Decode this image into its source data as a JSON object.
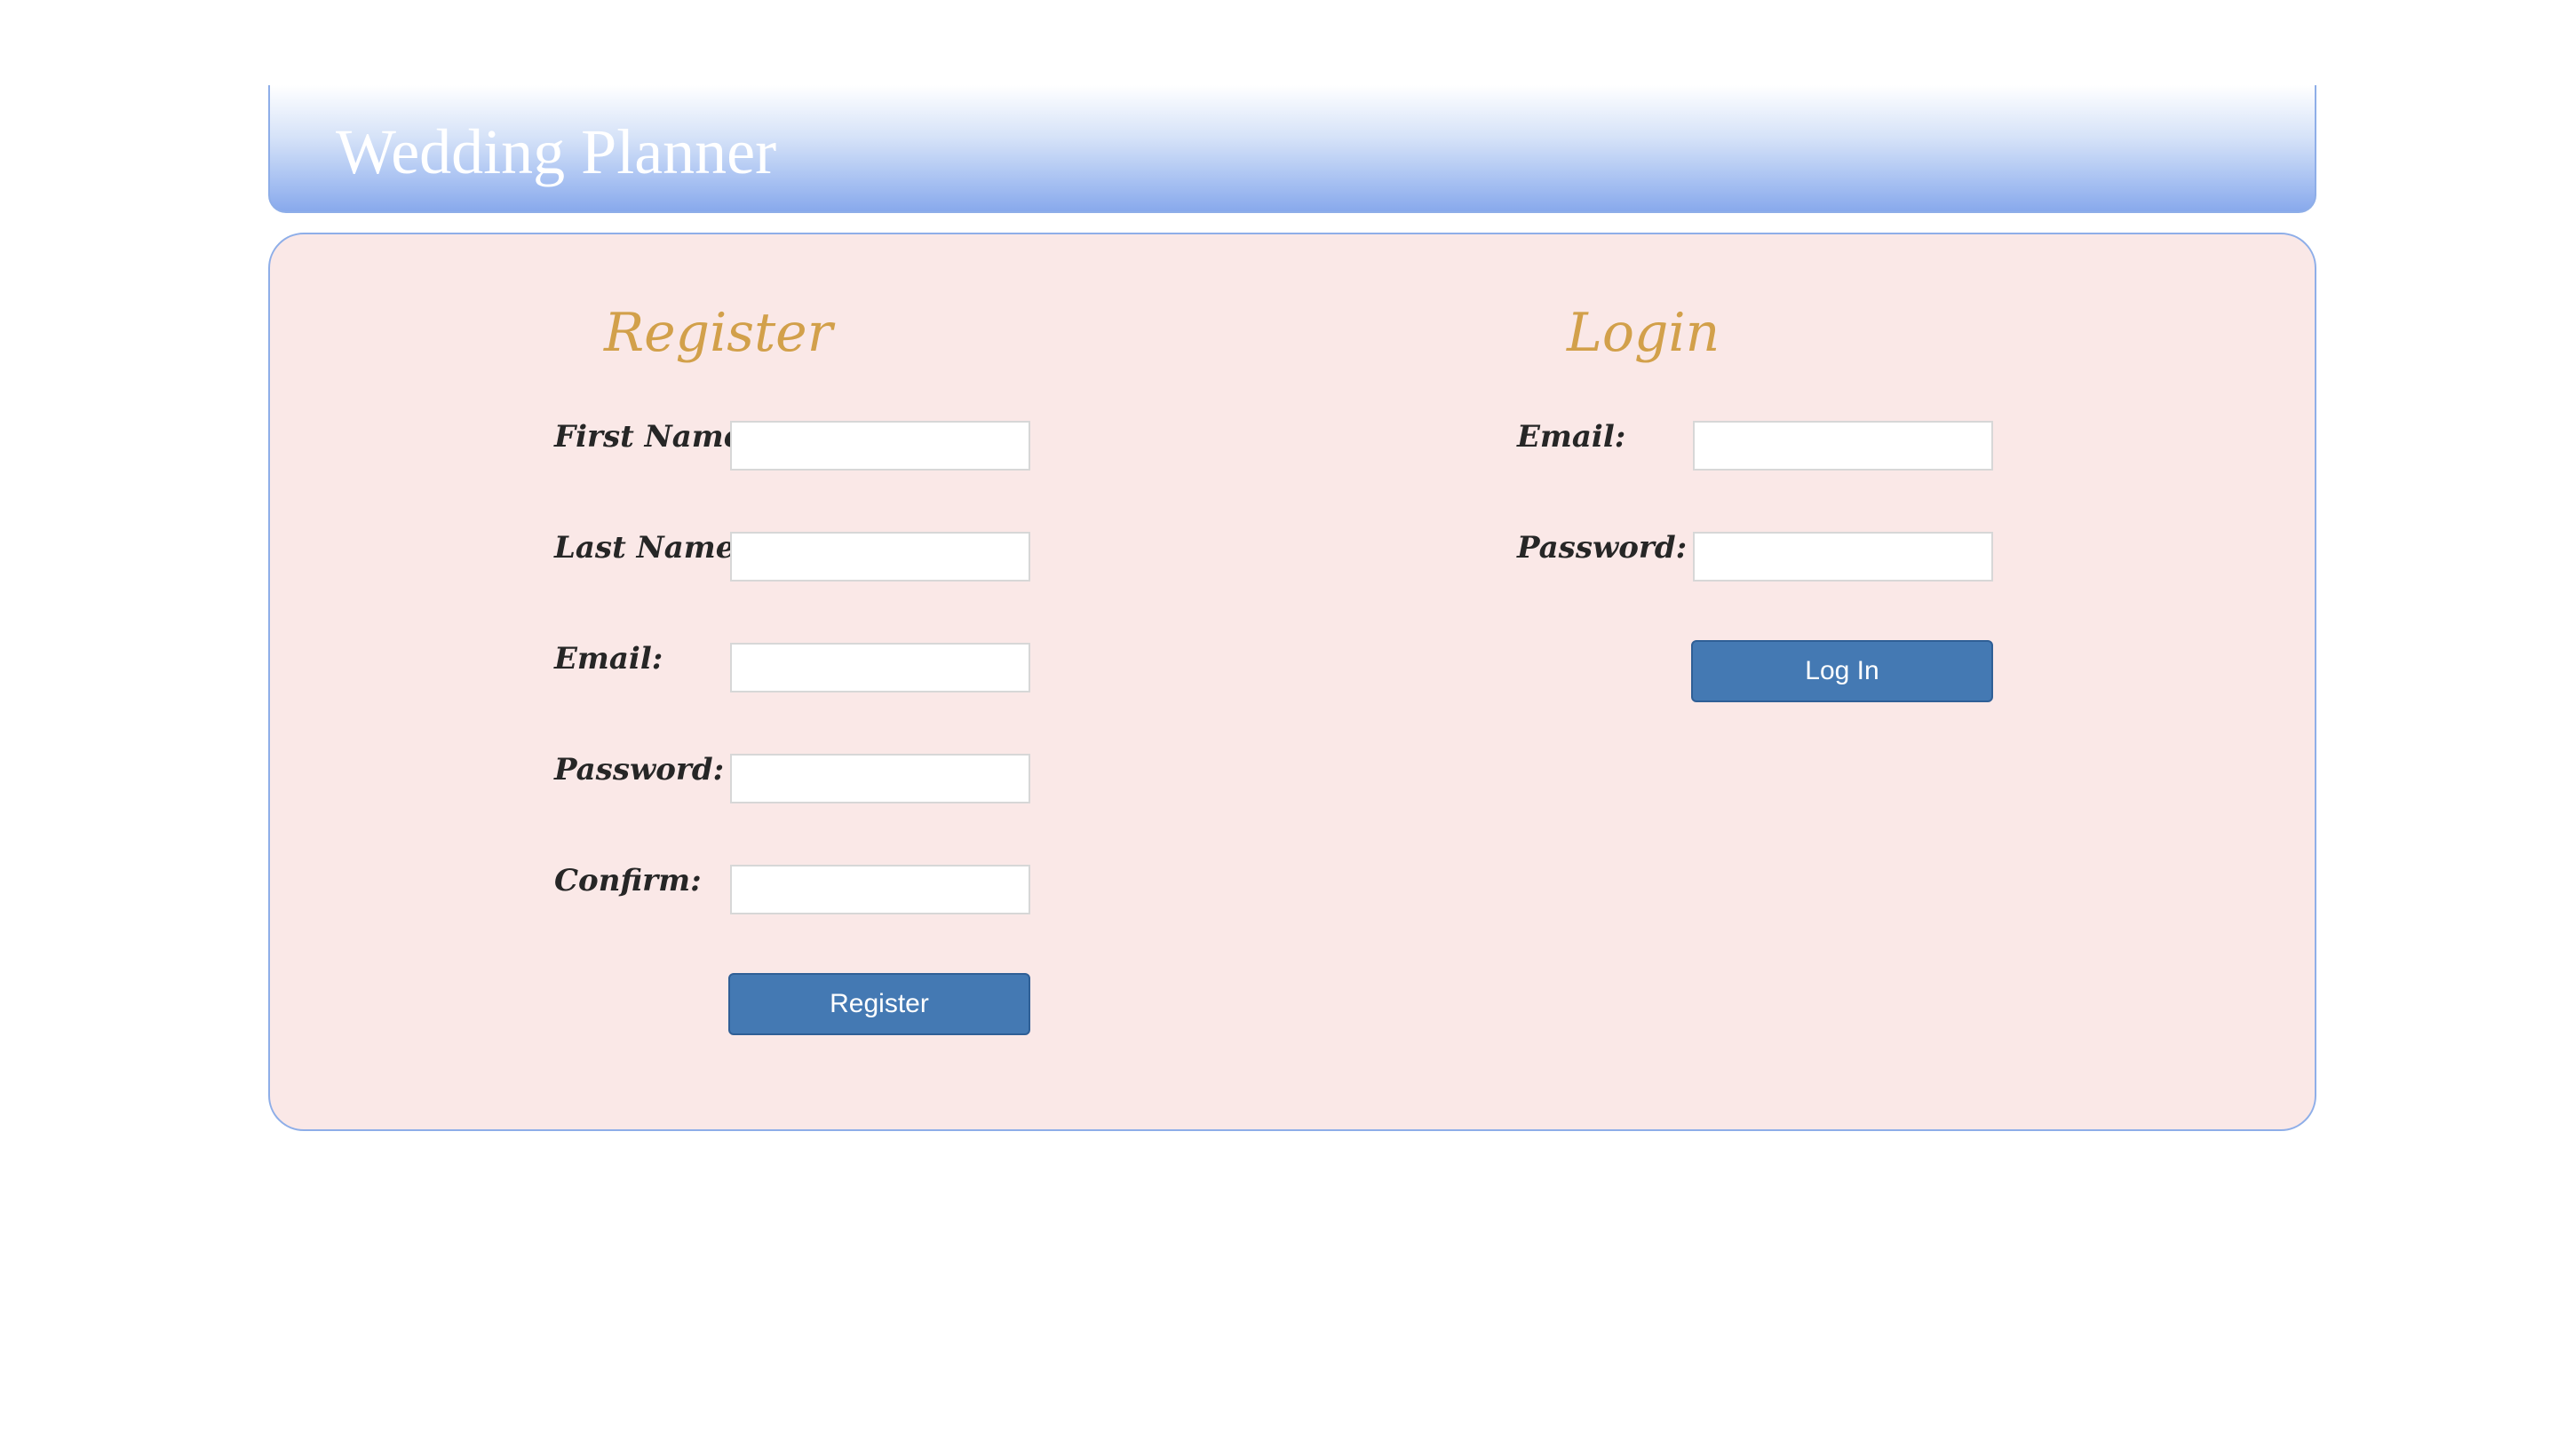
{
  "header": {
    "title": "Wedding Planner"
  },
  "register": {
    "title": "Register",
    "fields": [
      {
        "label": "First Name:",
        "value": ""
      },
      {
        "label": "Last Name:",
        "value": ""
      },
      {
        "label": "Email:",
        "value": ""
      },
      {
        "label": "Password:",
        "value": ""
      },
      {
        "label": "Confirm:",
        "value": ""
      }
    ],
    "button_label": "Register"
  },
  "login": {
    "title": "Login",
    "fields": [
      {
        "label": "Email:",
        "value": ""
      },
      {
        "label": "Password:",
        "value": ""
      }
    ],
    "button_label": "Log In"
  },
  "colors": {
    "header_gradient_bottom": "#88a9ec",
    "panel_background": "#fae8e7",
    "panel_border": "#8eaee8",
    "section_title": "#d2a04a",
    "button": "#4479b3"
  }
}
